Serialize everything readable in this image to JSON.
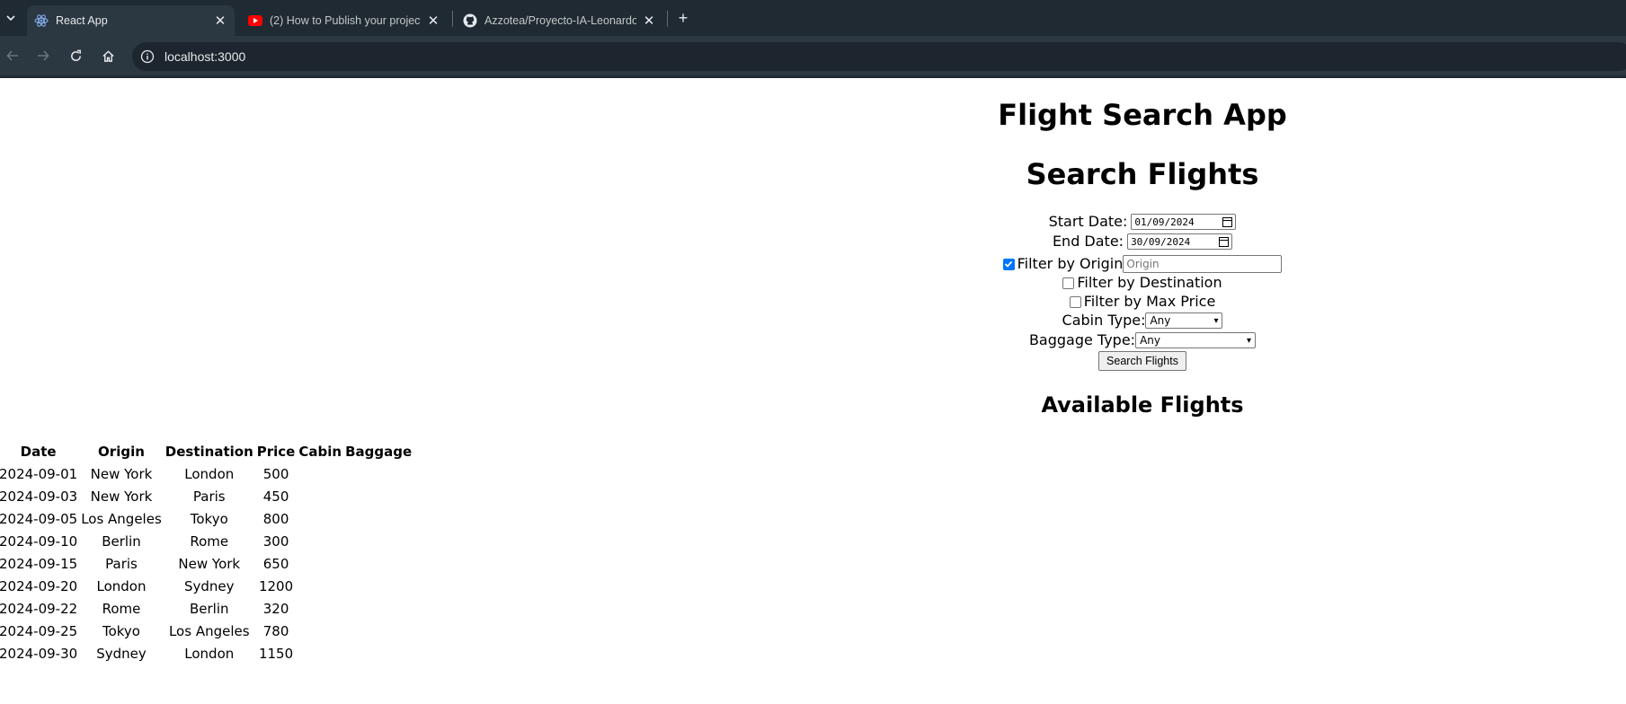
{
  "browser": {
    "tabs": [
      {
        "title": "React App",
        "icon": "react-icon",
        "active": true
      },
      {
        "title": "(2) How to Publish your project",
        "icon": "youtube-icon",
        "active": false
      },
      {
        "title": "Azzotea/Proyecto-IA-Leonardo",
        "icon": "github-icon",
        "active": false
      }
    ],
    "url": "localhost:3000"
  },
  "app": {
    "title": "Flight Search App",
    "search_title": "Search Flights",
    "form": {
      "start_label": "Start Date:",
      "start_value": "01/09/2024",
      "end_label": "End Date:",
      "end_value": "30/09/2024",
      "origin_label": "Filter by Origin",
      "origin_checked": true,
      "origin_placeholder": "Origin",
      "destination_label": "Filter by Destination",
      "destination_checked": false,
      "max_price_label": "Filter by Max Price",
      "max_price_checked": false,
      "cabin_label": "Cabin Type:",
      "cabin_value": "Any",
      "baggage_label": "Baggage Type:",
      "baggage_value": "Any",
      "search_button": "Search Flights"
    },
    "available_title": "Available Flights",
    "table": {
      "headers": [
        "Date",
        "Origin",
        "Destination",
        "Price",
        "Cabin",
        "Baggage"
      ],
      "rows": [
        {
          "date": "2024-09-01",
          "origin": "New York",
          "destination": "London",
          "price": "500",
          "cabin": "",
          "baggage": ""
        },
        {
          "date": "2024-09-03",
          "origin": "New York",
          "destination": "Paris",
          "price": "450",
          "cabin": "",
          "baggage": ""
        },
        {
          "date": "2024-09-05",
          "origin": "Los Angeles",
          "destination": "Tokyo",
          "price": "800",
          "cabin": "",
          "baggage": ""
        },
        {
          "date": "2024-09-10",
          "origin": "Berlin",
          "destination": "Rome",
          "price": "300",
          "cabin": "",
          "baggage": ""
        },
        {
          "date": "2024-09-15",
          "origin": "Paris",
          "destination": "New York",
          "price": "650",
          "cabin": "",
          "baggage": ""
        },
        {
          "date": "2024-09-20",
          "origin": "London",
          "destination": "Sydney",
          "price": "1200",
          "cabin": "",
          "baggage": ""
        },
        {
          "date": "2024-09-22",
          "origin": "Rome",
          "destination": "Berlin",
          "price": "320",
          "cabin": "",
          "baggage": ""
        },
        {
          "date": "2024-09-25",
          "origin": "Tokyo",
          "destination": "Los Angeles",
          "price": "780",
          "cabin": "",
          "baggage": ""
        },
        {
          "date": "2024-09-30",
          "origin": "Sydney",
          "destination": "London",
          "price": "1150",
          "cabin": "",
          "baggage": ""
        }
      ]
    }
  }
}
